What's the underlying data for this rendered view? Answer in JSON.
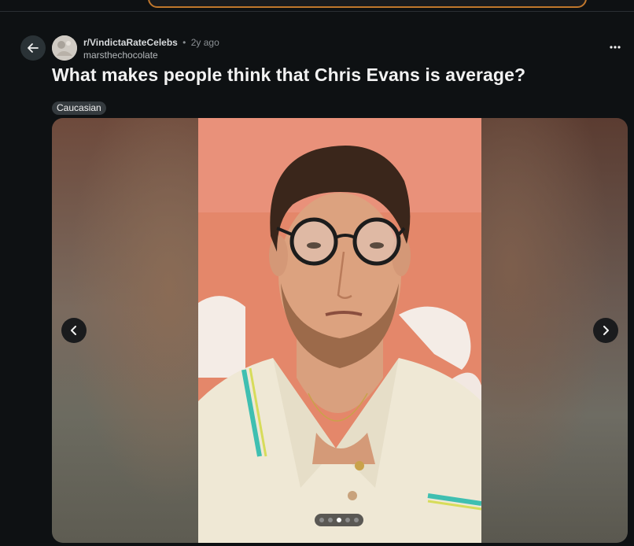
{
  "post": {
    "subreddit": "r/VindictaRateCelebs",
    "separator": "•",
    "time_ago": "2y ago",
    "author": "marsthechocolate",
    "title": "What makes people think that Chris Evans is average?",
    "flair": "Caucasian"
  },
  "gallery": {
    "image_count": 5,
    "current_index": 3,
    "photo_subject": "Chris Evans"
  },
  "icons": {
    "back": "arrow-left-icon",
    "more": "more-horizontal-icon",
    "prev": "chevron-left-icon",
    "next": "chevron-right-icon"
  },
  "colors": {
    "background": "#0e1113",
    "flair_bg": "#343a3e",
    "search_border": "#c0772c",
    "photo_backdrop": "#e4876a"
  }
}
